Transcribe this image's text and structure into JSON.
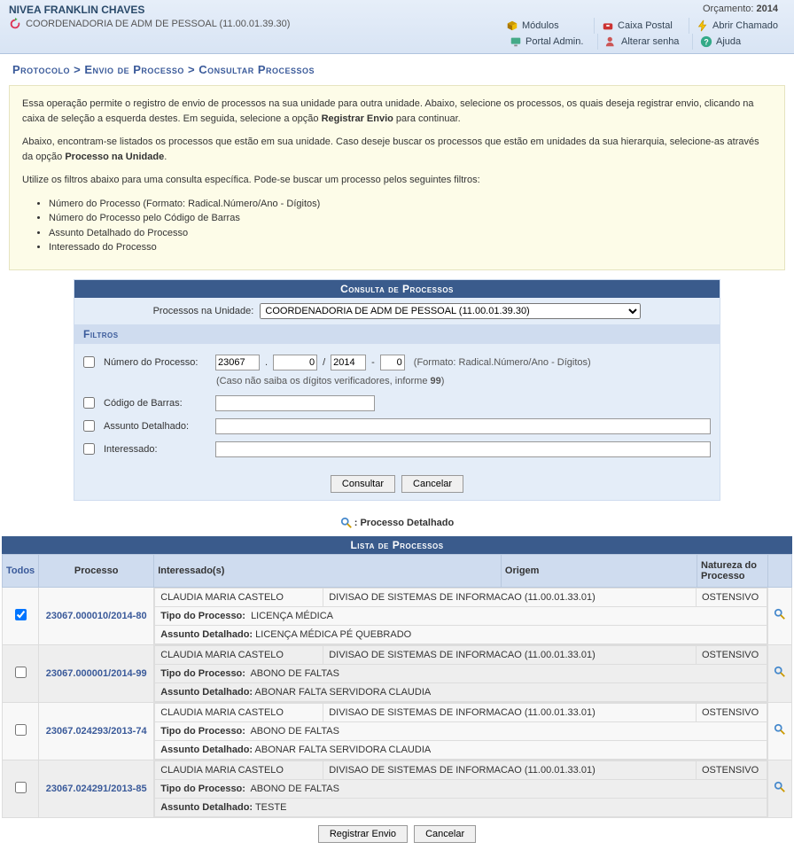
{
  "header": {
    "user_name": "NIVEA FRANKLIN CHAVES",
    "department": "COORDENADORIA DE ADM DE PESSOAL (11.00.01.39.30)",
    "orcamento_label": "Orçamento:",
    "orcamento_year": "2014",
    "links": {
      "modulos": "Módulos",
      "caixa_postal": "Caixa Postal",
      "abrir_chamado": "Abrir Chamado",
      "portal_admin": "Portal Admin.",
      "alterar_senha": "Alterar senha",
      "ajuda": "Ajuda"
    }
  },
  "breadcrumb": "Protocolo > Envio de Processo > Consultar Processos",
  "instructions": {
    "p1a": "Essa operação permite o registro de envio de processos na sua unidade para outra unidade. Abaixo, selecione os processos, os quais deseja registrar envio, clicando na caixa de seleção a esquerda destes. Em seguida, selecione a opção ",
    "p1b": "Registrar Envio",
    "p1c": " para continuar.",
    "p2a": "Abaixo, encontram-se listados os processos que estão em sua unidade. Caso deseje buscar os processos que estão em unidades da sua hierarquia, selecione-as através da opção ",
    "p2b": "Processo na Unidade",
    "p2c": ".",
    "p3": "Utilize os filtros abaixo para uma consulta específica. Pode-se buscar um processo pelos seguintes filtros:",
    "li1": "Número do Processo (Formato: Radical.Número/Ano - Dígitos)",
    "li2": "Número do Processo pelo Código de Barras",
    "li3": "Assunto Detalhado do Processo",
    "li4": "Interessado do Processo"
  },
  "consulta": {
    "title": "Consulta de Processos",
    "unit_label": "Processos na Unidade:",
    "unit_value": "COORDENADORIA DE ADM DE PESSOAL (11.00.01.39.30)",
    "filtros_title": "Filtros",
    "labels": {
      "numero": "Número do Processo:",
      "codigo": "Código de Barras:",
      "assunto": "Assunto Detalhado:",
      "interessado": "Interessado:"
    },
    "num_radical": "23067",
    "num_numero": "0",
    "num_ano": "2014",
    "num_digito": "0",
    "format_hint": "(Formato: Radical.Número/Ano - Dígitos)",
    "digits_hint_a": "(Caso não saiba os dígitos verificadores, informe ",
    "digits_hint_b": "99",
    "digits_hint_c": ")",
    "btn_consultar": "Consultar",
    "btn_cancelar": "Cancelar"
  },
  "legend": ": Processo Detalhado",
  "lista": {
    "title": "Lista de Processos",
    "headers": {
      "todos": "Todos",
      "processo": "Processo",
      "interessado": "Interessado(s)",
      "origem": "Origem",
      "natureza": "Natureza do Processo"
    },
    "labels": {
      "tipo": "Tipo do Processo:",
      "assunto": "Assunto Detalhado:"
    },
    "rows": [
      {
        "checked": true,
        "processo": "23067.000010/2014-80",
        "interessado": "CLAUDIA MARIA CASTELO",
        "origem": "DIVISAO DE SISTEMAS DE INFORMACAO (11.00.01.33.01)",
        "natureza": "OSTENSIVO",
        "tipo": "LICENÇA MÉDICA",
        "assunto": "LICENÇA MÉDICA PÉ QUEBRADO"
      },
      {
        "checked": false,
        "processo": "23067.000001/2014-99",
        "interessado": "CLAUDIA MARIA CASTELO",
        "origem": "DIVISAO DE SISTEMAS DE INFORMACAO (11.00.01.33.01)",
        "natureza": "OSTENSIVO",
        "tipo": "ABONO DE FALTAS",
        "assunto": "ABONAR FALTA SERVIDORA CLAUDIA"
      },
      {
        "checked": false,
        "processo": "23067.024293/2013-74",
        "interessado": "CLAUDIA MARIA CASTELO",
        "origem": "DIVISAO DE SISTEMAS DE INFORMACAO (11.00.01.33.01)",
        "natureza": "OSTENSIVO",
        "tipo": "ABONO DE FALTAS",
        "assunto": "ABONAR FALTA SERVIDORA CLAUDIA"
      },
      {
        "checked": false,
        "processo": "23067.024291/2013-85",
        "interessado": "CLAUDIA MARIA CASTELO",
        "origem": "DIVISAO DE SISTEMAS DE INFORMACAO (11.00.01.33.01)",
        "natureza": "OSTENSIVO",
        "tipo": "ABONO DE FALTAS",
        "assunto": "TESTE"
      }
    ]
  },
  "bottom": {
    "registrar": "Registrar Envio",
    "cancelar": "Cancelar"
  }
}
